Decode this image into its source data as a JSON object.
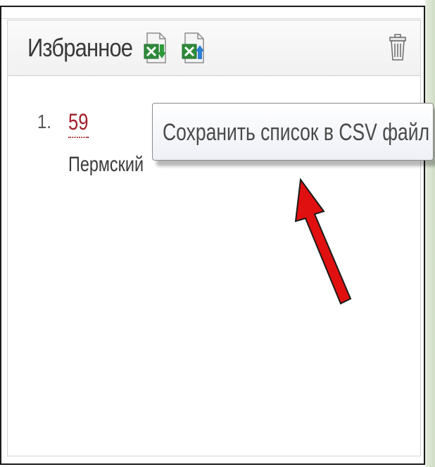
{
  "favorites": {
    "title": "Избранное",
    "download_icon": "excel-download-icon",
    "upload_icon": "excel-upload-icon",
    "clear_icon": "trash-icon",
    "items": [
      {
        "number": "1.",
        "code": "59",
        "region": "Пермский"
      }
    ]
  },
  "tooltip": {
    "text": "Сохранить список в CSV файл"
  },
  "colors": {
    "link": "#a1212b",
    "arrow": "#e01010",
    "excel_green": "#2e8b3a",
    "download_arrow": "#2e9a3a",
    "upload_arrow": "#2c7fd1"
  }
}
